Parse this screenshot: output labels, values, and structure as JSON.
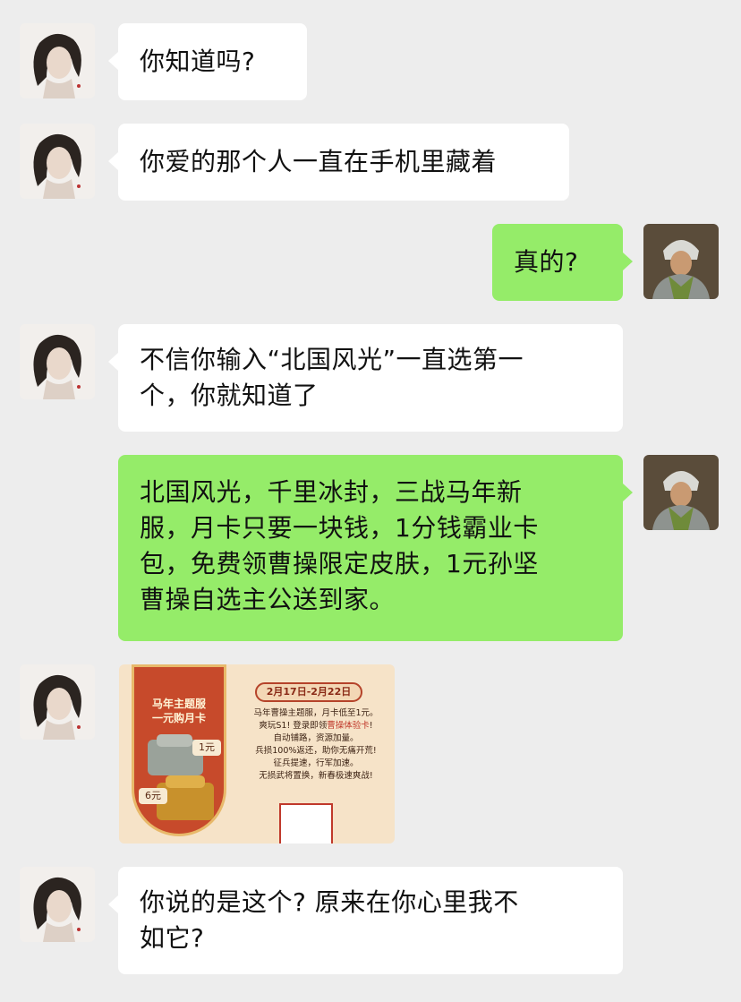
{
  "chat": {
    "messages": [
      {
        "side": "in",
        "lines": [
          "你知道吗?"
        ]
      },
      {
        "side": "in",
        "lines": [
          "你爱的那个人一直在手机里藏着"
        ]
      },
      {
        "side": "out",
        "lines": [
          "真的?"
        ]
      },
      {
        "side": "in",
        "lines": [
          "不信你输入“北国风光”一直选第一",
          "个，你就知道了"
        ]
      },
      {
        "side": "out",
        "lines": [
          "北国风光，千里冰封，三战马年新",
          "服，月卡只要一块钱，1分钱霸业卡",
          "包，免费领曹操限定皮肤，1元孙坚",
          "曹操自选主公送到家。"
        ]
      },
      {
        "side": "in",
        "type": "image"
      },
      {
        "side": "in",
        "lines": [
          "你说的是这个? 原来在你心里我不",
          "如它?"
        ]
      }
    ]
  },
  "promo": {
    "badge_title_1": "马年主题服",
    "badge_title_2": "一元购月卡",
    "price_small": "1元",
    "price_large": "6元",
    "date_range": "2月17日-2月22日",
    "desc_1": "马年曹操主题服，月卡低至1元。",
    "desc_2a": "爽玩S1! 登录即领",
    "desc_2b": "曹操体验卡",
    "desc_2c": "!",
    "desc_3": "自动铺路，资源加量。",
    "desc_4": "兵损100%返还，助你无痛开荒!",
    "desc_5": "征兵提速，行军加速。",
    "desc_6": "无损武将置换，新春极速爽战!"
  },
  "colors": {
    "background": "#ededed",
    "incoming_bubble": "#ffffff",
    "outgoing_bubble": "#95ec69"
  }
}
